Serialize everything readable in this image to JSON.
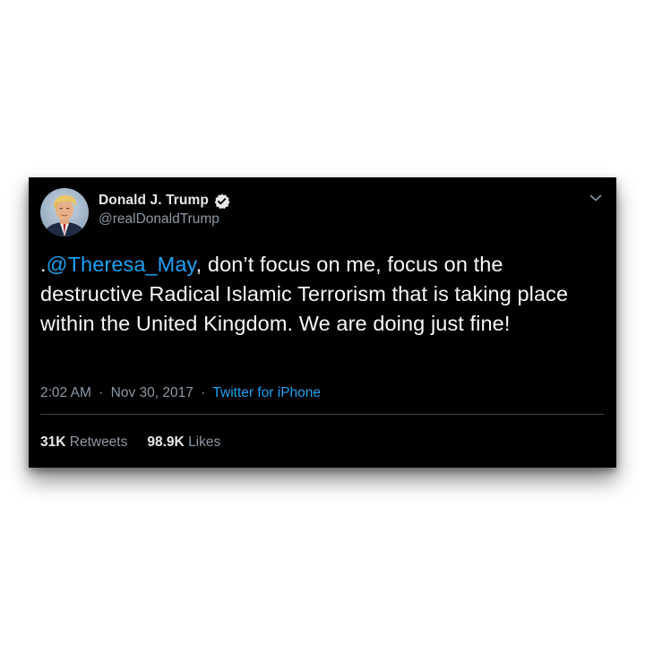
{
  "tweet": {
    "author": {
      "display_name": "Donald J. Trump",
      "handle": "@realDonaldTrump",
      "verified": true,
      "avatar_icon": "profile-photo"
    },
    "menu_icon": "chevron-down-icon",
    "text": {
      "prefix": ".",
      "mention": "@Theresa_May",
      "body": ", don’t focus on me, focus on the destructive Radical Islamic Terrorism that is taking place within the United Kingdom. We are doing just fine!"
    },
    "timestamp": "2:02 AM",
    "separator": "·",
    "date": "Nov 30, 2017",
    "source": "Twitter for iPhone",
    "stats": {
      "retweets_count": "31K",
      "retweets_label": "Retweets",
      "likes_count": "98.9K",
      "likes_label": "Likes"
    }
  },
  "colors": {
    "card_background": "#000000",
    "link": "#1da1f2",
    "muted_text": "#8b98a5",
    "primary_text": "#f5f8fa",
    "divider": "#38444d"
  }
}
